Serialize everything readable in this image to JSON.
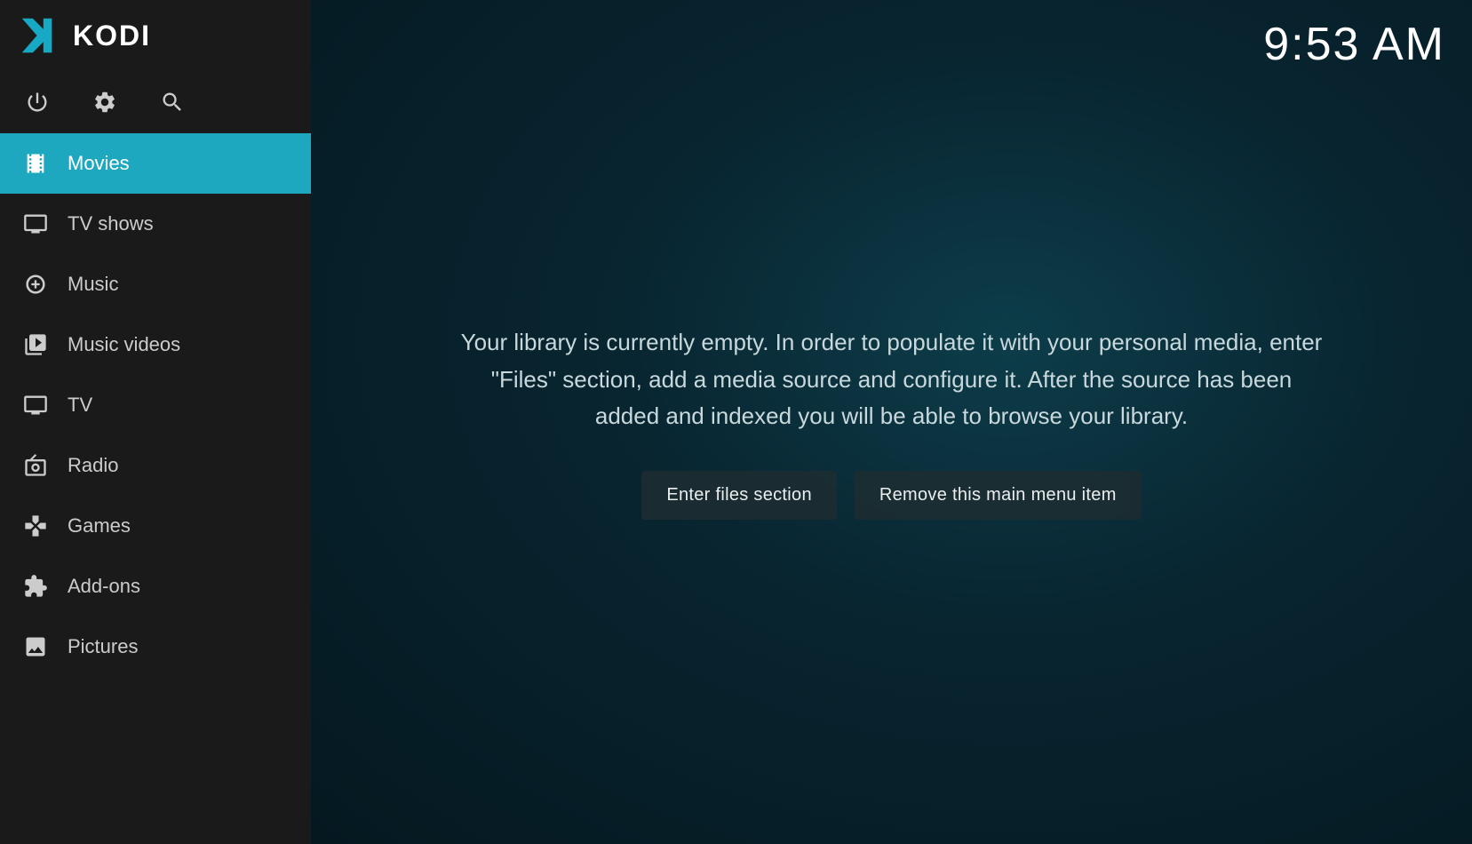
{
  "app": {
    "title": "KODI",
    "clock": "9:53 AM"
  },
  "sidebar": {
    "icons": [
      {
        "name": "power-icon",
        "label": "Power"
      },
      {
        "name": "settings-icon",
        "label": "Settings"
      },
      {
        "name": "search-icon",
        "label": "Search"
      }
    ],
    "nav_items": [
      {
        "id": "movies",
        "label": "Movies",
        "icon": "movies-icon",
        "active": true
      },
      {
        "id": "tv-shows",
        "label": "TV shows",
        "icon": "tv-shows-icon",
        "active": false
      },
      {
        "id": "music",
        "label": "Music",
        "icon": "music-icon",
        "active": false
      },
      {
        "id": "music-videos",
        "label": "Music videos",
        "icon": "music-videos-icon",
        "active": false
      },
      {
        "id": "tv",
        "label": "TV",
        "icon": "tv-icon",
        "active": false
      },
      {
        "id": "radio",
        "label": "Radio",
        "icon": "radio-icon",
        "active": false
      },
      {
        "id": "games",
        "label": "Games",
        "icon": "games-icon",
        "active": false
      },
      {
        "id": "add-ons",
        "label": "Add-ons",
        "icon": "addons-icon",
        "active": false
      },
      {
        "id": "pictures",
        "label": "Pictures",
        "icon": "pictures-icon",
        "active": false
      }
    ]
  },
  "main": {
    "library_message": "Your library is currently empty. In order to populate it with your personal media, enter \"Files\" section, add a media source and configure it. After the source has been added and indexed you will be able to browse your library.",
    "btn_enter_files": "Enter files section",
    "btn_remove_menu": "Remove this main menu item"
  }
}
